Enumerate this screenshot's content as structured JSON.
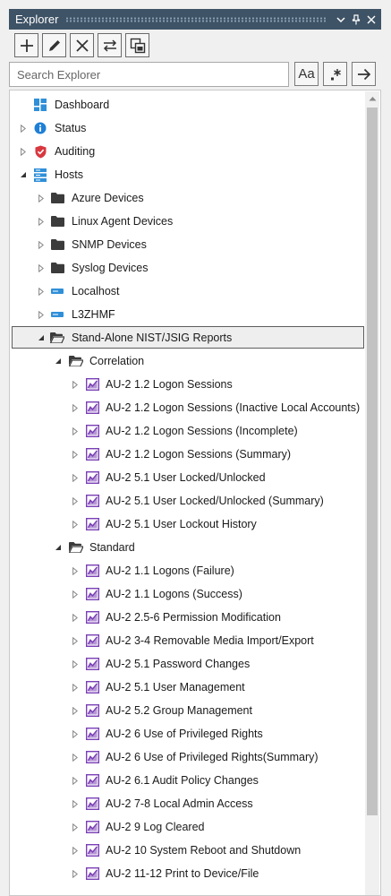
{
  "panel": {
    "title": "Explorer"
  },
  "search": {
    "placeholder": "Search Explorer"
  },
  "buttons": {
    "match_case": "Aa"
  },
  "colors": {
    "titlebar": "#3f5366",
    "folder": "#3b3b3b",
    "report": "#7a3fb5",
    "info": "#1e7fd6",
    "shield": "#d9383f",
    "host": "#2f8fd8"
  },
  "tree": [
    {
      "label": "Dashboard",
      "icon": "dashboard-icon",
      "level": 0,
      "expander": "none"
    },
    {
      "label": "Status",
      "icon": "info-icon",
      "level": 0,
      "expander": "collapsed"
    },
    {
      "label": "Auditing",
      "icon": "shield-icon",
      "level": 0,
      "expander": "collapsed"
    },
    {
      "label": "Hosts",
      "icon": "hosts-icon",
      "level": 0,
      "expander": "expanded"
    },
    {
      "label": "Azure Devices",
      "icon": "folder-icon",
      "level": 1,
      "expander": "collapsed"
    },
    {
      "label": "Linux Agent Devices",
      "icon": "folder-icon",
      "level": 1,
      "expander": "collapsed"
    },
    {
      "label": "SNMP Devices",
      "icon": "folder-icon",
      "level": 1,
      "expander": "collapsed"
    },
    {
      "label": "Syslog Devices",
      "icon": "folder-icon",
      "level": 1,
      "expander": "collapsed"
    },
    {
      "label": "Localhost",
      "icon": "host-icon",
      "level": 1,
      "expander": "collapsed"
    },
    {
      "label": "L3ZHMF",
      "icon": "host-icon",
      "level": 1,
      "expander": "collapsed"
    },
    {
      "label": "Stand-Alone NIST/JSIG Reports",
      "icon": "folder-open-icon",
      "level": 1,
      "expander": "expanded",
      "selected": true
    },
    {
      "label": "Correlation",
      "icon": "folder-open-icon",
      "level": 2,
      "expander": "expanded"
    },
    {
      "label": "AU-2  1.2 Logon Sessions",
      "icon": "report-icon",
      "level": 3,
      "expander": "collapsed"
    },
    {
      "label": "AU-2  1.2 Logon Sessions (Inactive Local Accounts)",
      "icon": "report-icon",
      "level": 3,
      "expander": "collapsed"
    },
    {
      "label": "AU-2  1.2 Logon Sessions (Incomplete)",
      "icon": "report-icon",
      "level": 3,
      "expander": "collapsed"
    },
    {
      "label": "AU-2  1.2 Logon Sessions (Summary)",
      "icon": "report-icon",
      "level": 3,
      "expander": "collapsed"
    },
    {
      "label": "AU-2  5.1 User Locked/Unlocked",
      "icon": "report-icon",
      "level": 3,
      "expander": "collapsed"
    },
    {
      "label": "AU-2  5.1 User Locked/Unlocked (Summary)",
      "icon": "report-icon",
      "level": 3,
      "expander": "collapsed"
    },
    {
      "label": "AU-2  5.1 User Lockout History",
      "icon": "report-icon",
      "level": 3,
      "expander": "collapsed"
    },
    {
      "label": "Standard",
      "icon": "folder-open-icon",
      "level": 2,
      "expander": "expanded"
    },
    {
      "label": "AU-2  1.1 Logons (Failure)",
      "icon": "report-icon",
      "level": 3,
      "expander": "collapsed"
    },
    {
      "label": "AU-2  1.1 Logons (Success)",
      "icon": "report-icon",
      "level": 3,
      "expander": "collapsed"
    },
    {
      "label": "AU-2  2.5-6 Permission Modification",
      "icon": "report-icon",
      "level": 3,
      "expander": "collapsed"
    },
    {
      "label": "AU-2  3-4 Removable Media Import/Export",
      "icon": "report-icon",
      "level": 3,
      "expander": "collapsed"
    },
    {
      "label": "AU-2  5.1 Password Changes",
      "icon": "report-icon",
      "level": 3,
      "expander": "collapsed"
    },
    {
      "label": "AU-2  5.1 User Management",
      "icon": "report-icon",
      "level": 3,
      "expander": "collapsed"
    },
    {
      "label": "AU-2  5.2 Group Management",
      "icon": "report-icon",
      "level": 3,
      "expander": "collapsed"
    },
    {
      "label": "AU-2  6 Use of Privileged Rights",
      "icon": "report-icon",
      "level": 3,
      "expander": "collapsed"
    },
    {
      "label": "AU-2  6 Use of Privileged Rights(Summary)",
      "icon": "report-icon",
      "level": 3,
      "expander": "collapsed"
    },
    {
      "label": "AU-2  6.1 Audit Policy Changes",
      "icon": "report-icon",
      "level": 3,
      "expander": "collapsed"
    },
    {
      "label": "AU-2  7-8 Local Admin Access",
      "icon": "report-icon",
      "level": 3,
      "expander": "collapsed"
    },
    {
      "label": "AU-2  9 Log Cleared",
      "icon": "report-icon",
      "level": 3,
      "expander": "collapsed"
    },
    {
      "label": "AU-2 10 System Reboot and Shutdown",
      "icon": "report-icon",
      "level": 3,
      "expander": "collapsed"
    },
    {
      "label": "AU-2 11-12 Print to Device/File",
      "icon": "report-icon",
      "level": 3,
      "expander": "collapsed"
    }
  ]
}
